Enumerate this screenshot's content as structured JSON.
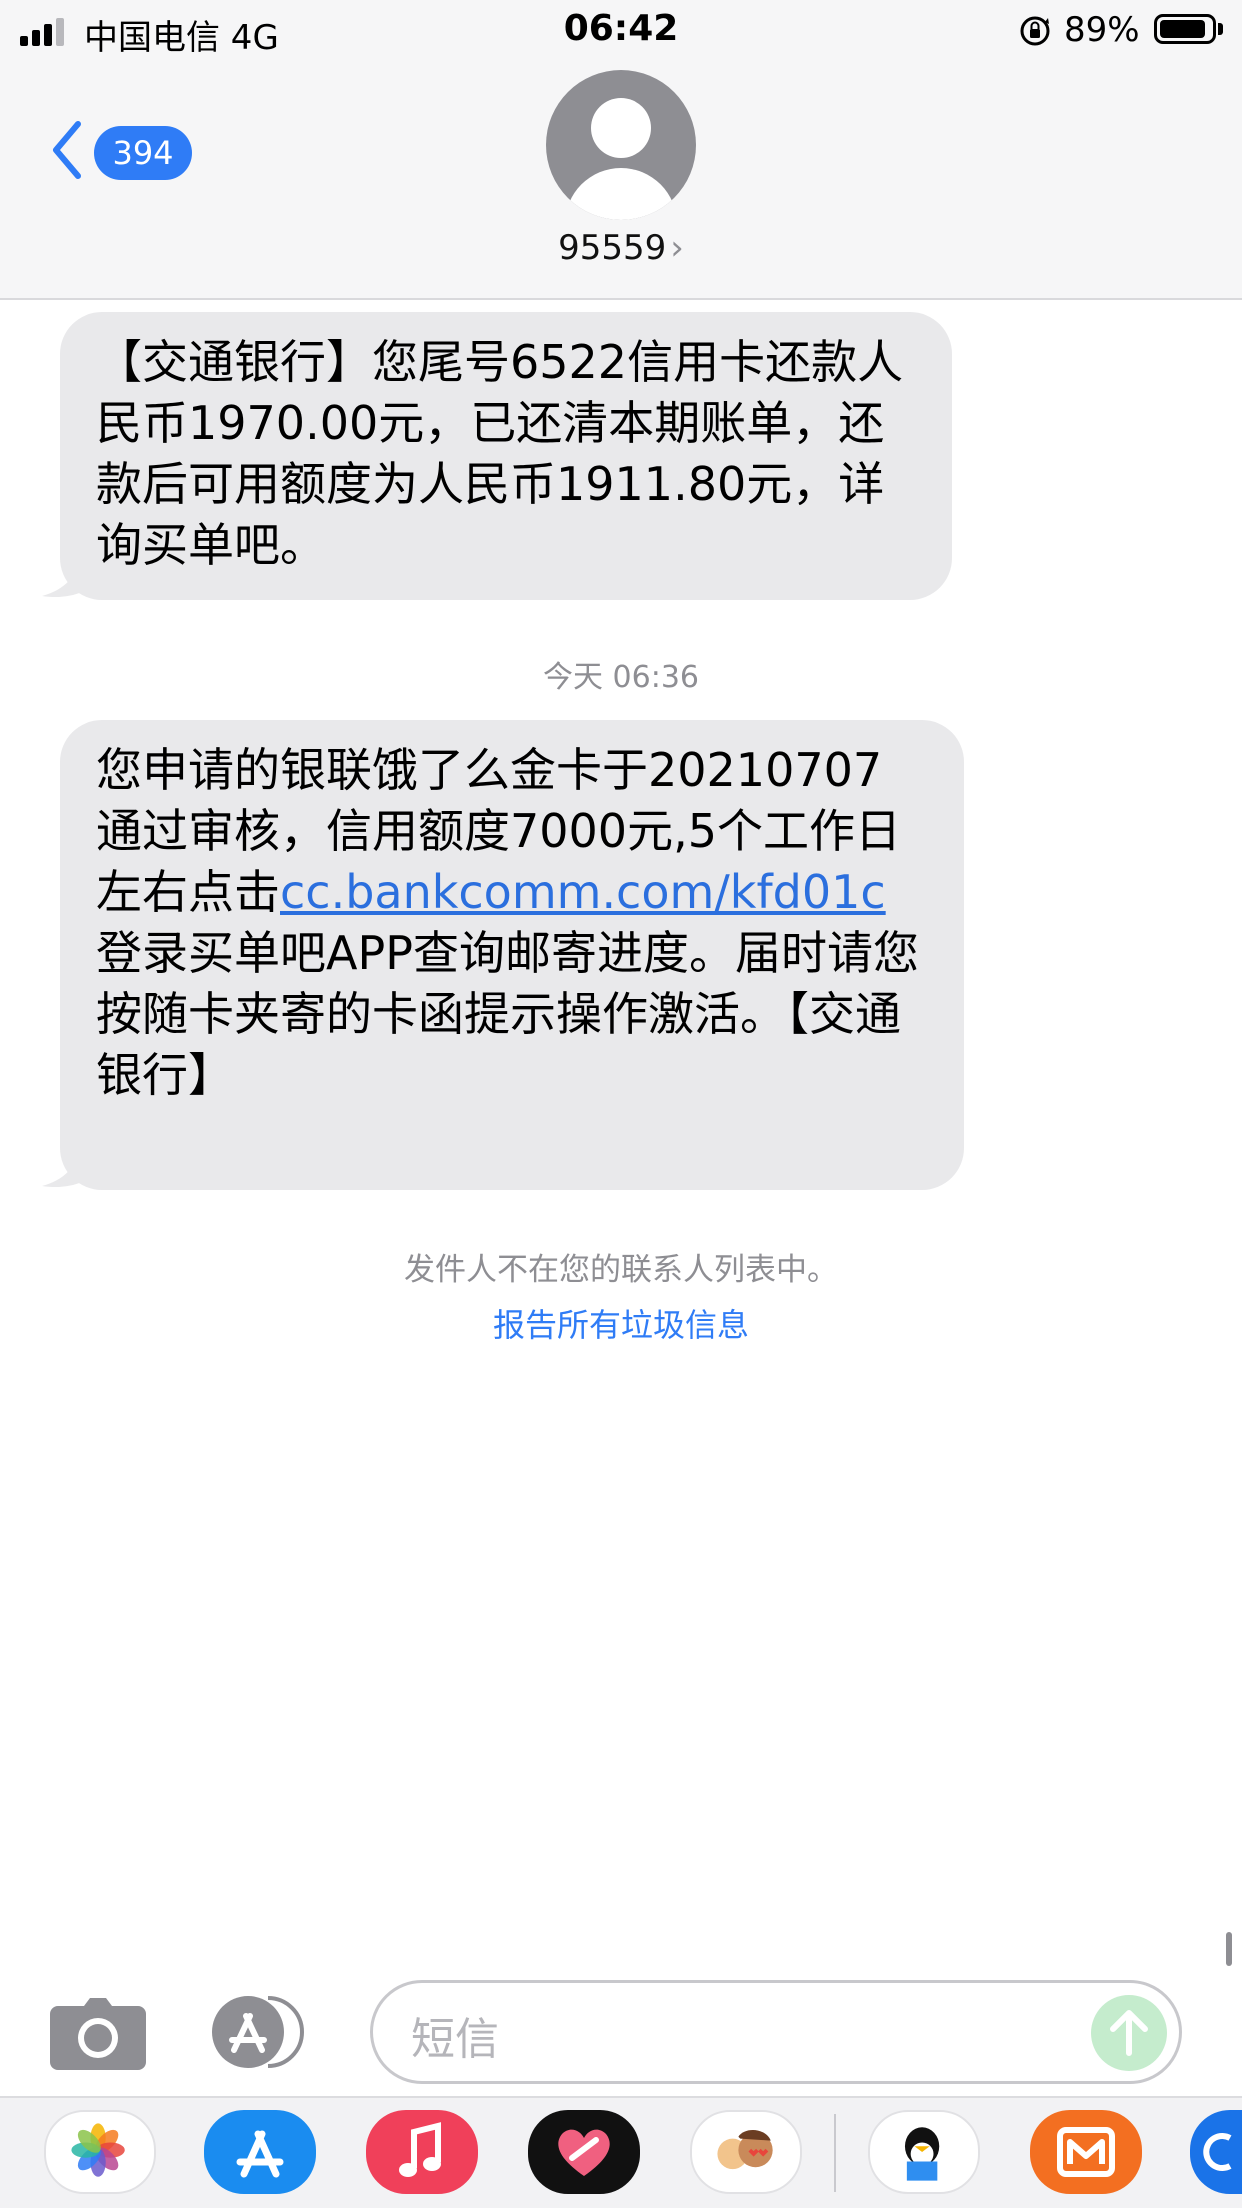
{
  "status_bar": {
    "carrier": "中国电信   4G",
    "time": "06:42",
    "battery_percent": "89%",
    "battery_level": 0.89
  },
  "header": {
    "back_badge": "394",
    "contact": "95559",
    "contact_chevron": "›"
  },
  "messages": [
    {
      "text": "【交通银行】您尾号6522信用卡还款人民币1970.00元，已还清本期账单，还款后可用额度为人民币1911.80元，详询买单吧。"
    },
    {
      "timestamp": "今天 06:36",
      "text_before_link": "您申请的银联饿了么金卡于20210707通过审核，信用额度7000元,5个工作日左右点击",
      "link": "cc.bankcomm.com/kfd01c",
      "text_after_link": "登录买单吧APP查询邮寄进度。届时请您按随卡夹寄的卡函提示操作激活。【交通银行】"
    }
  ],
  "notice": "发件人不在您的联系人列表中。",
  "report_link": "报告所有垃圾信息",
  "input": {
    "placeholder": "短信"
  },
  "icons": {
    "camera": "camera-icon",
    "app_store": "app-store-icon",
    "send": "send-arrow-icon"
  },
  "colors": {
    "accent": "#2f7cf6",
    "bubble": "#e9e9eb",
    "link": "#2b6fde"
  }
}
